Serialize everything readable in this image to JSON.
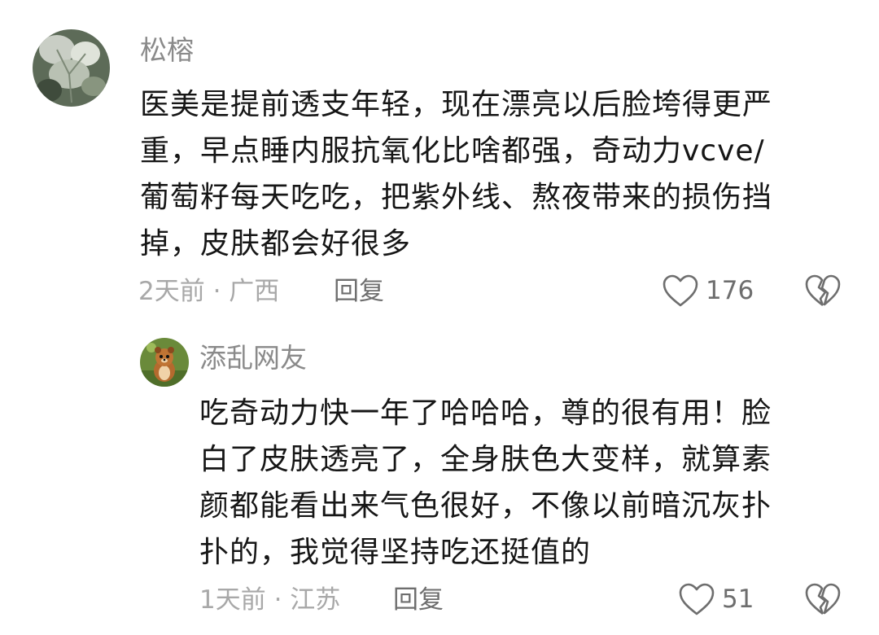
{
  "comments": [
    {
      "username": "松榕",
      "lines": [
        "医美是提前透支年轻，现在漂亮以后脸垮得更严",
        "重，早点睡内服抗氧化比啥都强，奇动力vcve/",
        "葡萄籽每天吃吃，把紫外线、熬夜带来的损伤挡",
        "掉，皮肤都会好很多"
      ],
      "meta": "2天前 · 广西",
      "reply_label": "回复",
      "like_count": "176",
      "avatar_icon": "leaf-photo-avatar"
    },
    {
      "username": "添乱网友",
      "lines": [
        "吃奇动力快一年了哈哈哈，尊的很有用！脸",
        "白了皮肤透亮了，全身肤色大变样，就算素",
        "颜都能看出来气色很好，不像以前暗沉灰扑",
        "扑的，我觉得坚持吃还挺值的"
      ],
      "meta": "1天前 · 江苏",
      "reply_label": "回复",
      "like_count": "51",
      "avatar_icon": "cartoon-chipmunk-avatar"
    }
  ],
  "colors": {
    "username": "#8a8a8a",
    "body_text": "#161616",
    "meta": "#a8a8a8",
    "action": "#6e6e6e"
  }
}
